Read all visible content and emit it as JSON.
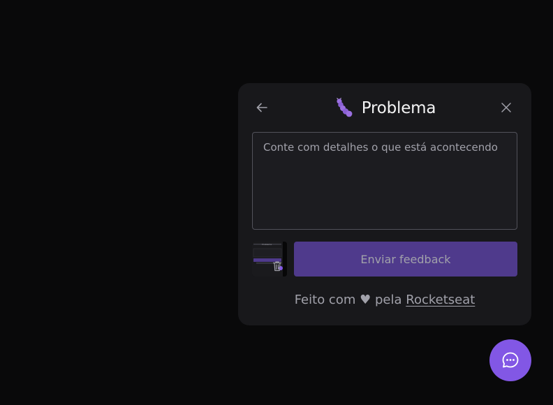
{
  "widget": {
    "title": "Problema",
    "title_icon": "bug-icon",
    "back_icon": "arrow-left-icon",
    "close_icon": "x-icon",
    "comment_placeholder": "Conte com detalhes o que está acontecendo",
    "submit_label": "Enviar feedback",
    "screenshot_action_icon": "trash-icon"
  },
  "footer": {
    "prefix": "Feito com",
    "heart": "♥",
    "middle": "pela",
    "link_text": "Rocketseat"
  },
  "fab": {
    "icon": "chat-dots-icon"
  },
  "colors": {
    "background": "#09090a",
    "surface": "#18181b",
    "brand": "#8257e5",
    "brand_muted": "#4f3a8c",
    "text_primary": "#f4f4f5",
    "text_secondary": "#a1a1aa",
    "border": "#52525b"
  }
}
